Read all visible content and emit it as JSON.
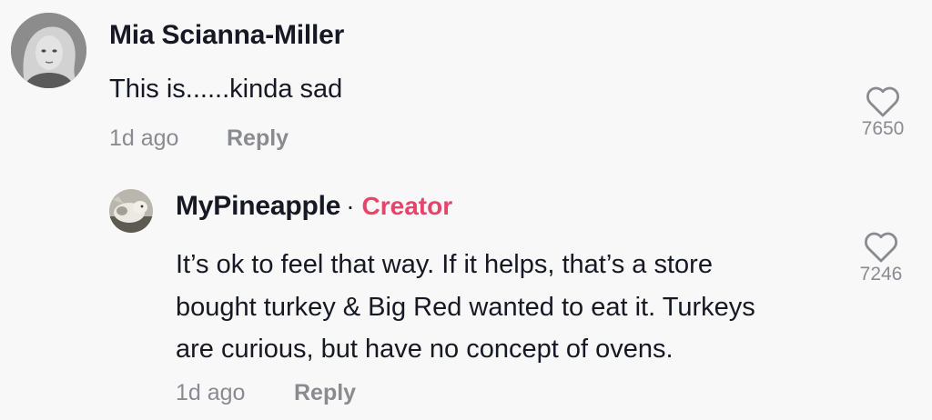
{
  "comment": {
    "username": "Mia Scianna-Miller",
    "text": "This is......kinda sad",
    "timestamp": "1d ago",
    "reply_label": "Reply",
    "like_count": "7650",
    "avatar_icon": "user-avatar-photo"
  },
  "reply": {
    "username": "MyPineapple",
    "separator": "·",
    "badge": "Creator",
    "text_lines": [
      "It’s ok to feel that way. If it helps, that’s a store",
      "bought turkey & Big Red wanted to eat it. Turkeys",
      "are curious, but have no concept of ovens."
    ],
    "timestamp": "1d ago",
    "reply_label": "Reply",
    "like_count": "7246",
    "avatar_icon": "creator-avatar-photo"
  },
  "colors": {
    "background": "#f8f8f8",
    "primary_text": "#161823",
    "secondary_text": "#8a8b91",
    "creator_badge": "#e8436b"
  },
  "icons": {
    "like": "heart-outline-icon"
  }
}
